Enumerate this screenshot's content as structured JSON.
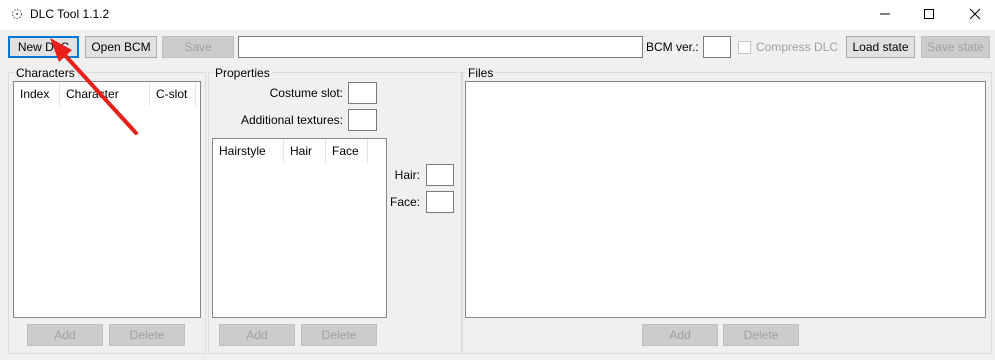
{
  "window": {
    "title": "DLC Tool 1.1.2",
    "icons": [
      "app-icon",
      "minimize-icon",
      "maximize-icon",
      "close-icon"
    ]
  },
  "toolbar": {
    "new_dlc": "New DLC",
    "open_bcm": "Open BCM",
    "save": "Save",
    "path_value": "",
    "bcm_ver_label": "BCM ver.:",
    "bcm_ver_value": "",
    "compress_label": "Compress DLC",
    "compress_checked": false,
    "load_state": "Load state",
    "save_state": "Save state"
  },
  "characters": {
    "title": "Characters",
    "columns": [
      "Index",
      "Character",
      "C-slot"
    ],
    "rows": [],
    "add": "Add",
    "delete": "Delete"
  },
  "properties": {
    "title": "Properties",
    "costume_slot_label": "Costume slot:",
    "costume_slot_value": "",
    "additional_textures_label": "Additional textures:",
    "additional_textures_value": "",
    "columns": [
      "Hairstyle",
      "Hair",
      "Face"
    ],
    "rows": [],
    "hair_label": "Hair:",
    "hair_value": "",
    "face_label": "Face:",
    "face_value": "",
    "add": "Add",
    "delete": "Delete"
  },
  "files": {
    "title": "Files",
    "rows": [],
    "add": "Add",
    "delete": "Delete"
  },
  "annotation": {
    "color": "#e8201a",
    "icon": "red-arrow-icon"
  }
}
